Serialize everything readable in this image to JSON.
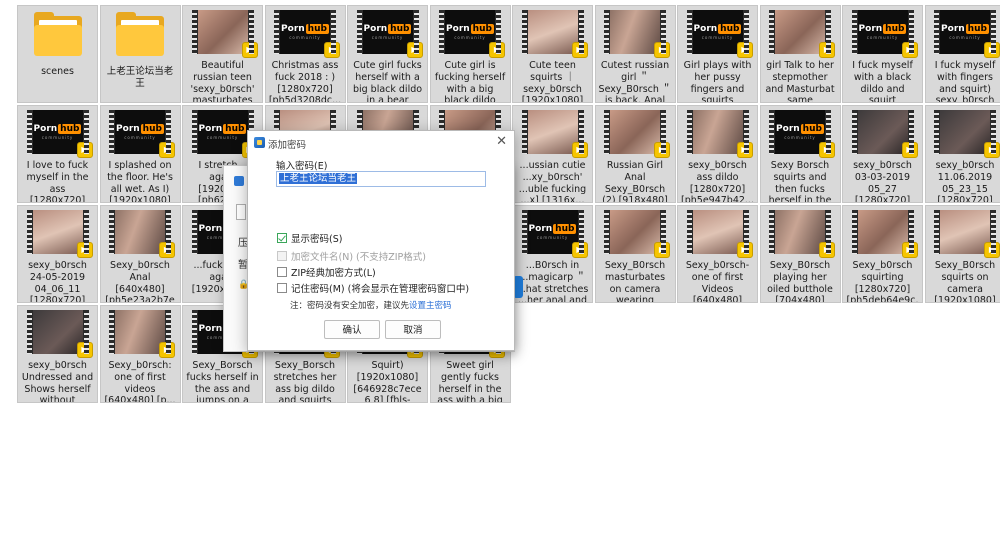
{
  "files": [
    {
      "type": "folder",
      "label": "scenes"
    },
    {
      "type": "folder",
      "label": "上老王论坛当老王"
    },
    {
      "type": "video",
      "thumb": "skin1",
      "label": "Beautiful russian teen 'sexy_b0rsch' masturbates i..."
    },
    {
      "type": "video",
      "thumb": "ph",
      "label": "Christmas ass fuck 2018 : ) [1280x720] [ph5d3208dc..."
    },
    {
      "type": "video",
      "thumb": "ph",
      "label": "Cute girl fucks herself with a big black dildo in a bear costu..."
    },
    {
      "type": "video",
      "thumb": "ph",
      "label": "Cute girl is fucking herself with a big black dildo [1920x1..."
    },
    {
      "type": "video",
      "thumb": "skin2",
      "label": "Cute teen squirts ｜ sexy_b0rsch [1920x1080] [..."
    },
    {
      "type": "video",
      "thumb": "skin3",
      "label": "Cutest russian girl ＂ Sexy_B0rsch ＂ is back. Anal o..."
    },
    {
      "type": "video",
      "thumb": "ph",
      "label": "Girl plays with her pussy fingers and squirts [1920x..."
    },
    {
      "type": "video",
      "thumb": "skin1",
      "label": "girl Talk to her stepmother and Masturbat same time(cha..."
    },
    {
      "type": "video",
      "thumb": "ph",
      "label": "I fuck myself with a black dildo and squirt [1280x720] [p..."
    },
    {
      "type": "video",
      "thumb": "ph",
      "label": "I fuck myself with fingers and squirt) sexy_b0rsch [1..."
    },
    {
      "type": "video",
      "thumb": "ph",
      "label": "I love to fuck myself in the ass [1280x720] [ph5d3203eb..."
    },
    {
      "type": "video",
      "thumb": "ph",
      "label": "I splashed on the floor. He's all wet. As I) [1920x1080] [..."
    },
    {
      "type": "video",
      "thumb": "ph",
      "label": "I stretch... aga... [1920x1... [ph624b..."
    },
    {
      "type": "video",
      "thumb": "skin2",
      "label": ""
    },
    {
      "type": "video",
      "thumb": "skin3",
      "label": ""
    },
    {
      "type": "video",
      "thumb": "skin1",
      "label": ""
    },
    {
      "type": "video",
      "thumb": "skin2",
      "label": "...ussian cutie ...xy_b0rsch' ...uble fucking ...x] [1316x..."
    },
    {
      "type": "video",
      "thumb": "skin1",
      "label": "Russian Girl Anal Sexy_B0rsch (2) [918x480] [ph..."
    },
    {
      "type": "video",
      "thumb": "skin3",
      "label": "sexy_b0rsch ass dildo [1280x720] [ph5e947b42..."
    },
    {
      "type": "video",
      "thumb": "ph",
      "label": "Sexy Borsch squirts and then fucks herself in the a..."
    },
    {
      "type": "video",
      "thumb": "dark",
      "label": "sexy_b0rsch 03-03-2019 05_27 [1280x720] [p..."
    },
    {
      "type": "video",
      "thumb": "dark",
      "label": "sexy_b0rsch 11.06.2019 05_23_15 [1280x720] [p..."
    },
    {
      "type": "video",
      "thumb": "skin2",
      "label": "sexy_b0rsch 24-05-2019 04_06_11 [1280x720] [p..."
    },
    {
      "type": "video",
      "thumb": "skin3",
      "label": "Sexy_b0rsch Anal [640x480] [ph5e23a2b7e8 749] [fhls-428..."
    },
    {
      "type": "video",
      "thumb": "ph",
      "label": "...fucks he... again [1920x1080]"
    },
    {
      "type": "video",
      "thumb": "skin1",
      "label": ""
    },
    {
      "type": "video",
      "thumb": "skin2",
      "label": ""
    },
    {
      "type": "video",
      "thumb": "skin3",
      "label": ""
    },
    {
      "type": "video",
      "thumb": "ph",
      "label": "...B0rsch in ...magicarp ＂ ...hat stretches ...her anal and s..."
    },
    {
      "type": "video",
      "thumb": "skin1",
      "label": "Sexy_B0rsch masturbates on camera wearing glasses. [1920..."
    },
    {
      "type": "video",
      "thumb": "skin2",
      "label": "Sexy_b0rsch- one of first Videos [640x480] [ph..."
    },
    {
      "type": "video",
      "thumb": "skin3",
      "label": "Sexy_B0rsch playing her oiled butthole [704x480] [ph..."
    },
    {
      "type": "video",
      "thumb": "skin1",
      "label": "Sexy_b0rsch squirting [1280x720] [ph5deb64e9c..."
    },
    {
      "type": "video",
      "thumb": "skin2",
      "label": "Sexy_B0rsch squirts on camera [1920x1080] [..."
    },
    {
      "type": "video",
      "thumb": "dark",
      "label": "sexy_b0rsch Undressed and Shows herself without Hesita..."
    },
    {
      "type": "video",
      "thumb": "skin3",
      "label": "Sexy_b0rsch: one of first videos [640x480] [p..."
    },
    {
      "type": "video",
      "thumb": "ph",
      "label": "Sexy_Borsch fucks herself in the ass and jumps on a hu..."
    },
    {
      "type": "video",
      "thumb": "ph",
      "label": "Sexy_Borsch stretches her ass big dildo and squirts ou..."
    },
    {
      "type": "video",
      "thumb": "ph",
      "label": "Squirt) [1920x1080] [646928c7ece6 8] [fhls-2804]...."
    },
    {
      "type": "video",
      "thumb": "ph",
      "label": "Sweet girl gently fucks herself in the ass with a big ..."
    }
  ],
  "video_badge": {
    "icon": "play-icon",
    "text": "Player"
  },
  "ph_logo": {
    "porn": "Porn",
    "hub": "hub",
    "sub": "community"
  },
  "bg_dialog": {
    "line1": "压",
    "line2": "暂"
  },
  "dialog": {
    "title": "添加密码",
    "close": "✕",
    "field_label": "输入密码(E)",
    "password_value": "上老王论坛当老王",
    "options": [
      {
        "label": "显示密码(S)",
        "checked": true,
        "disabled": false
      },
      {
        "label": "加密文件名(N) (不支持ZIP格式)",
        "checked": false,
        "disabled": true
      },
      {
        "label": "ZIP经典加密方式(L)",
        "checked": false,
        "disabled": false
      },
      {
        "label": "记住密码(M) (将会显示在管理密码窗口中)",
        "checked": false,
        "disabled": false
      }
    ],
    "note_prefix": "注：密码没有安全加密，建议先",
    "note_link": "设置主密码",
    "ok_label": "确认",
    "cancel_label": "取消"
  },
  "colors": {
    "accent": "#2f6fd6",
    "check": "#3aa65a",
    "badge": "#f6c500",
    "folder": "#ffc83d"
  }
}
